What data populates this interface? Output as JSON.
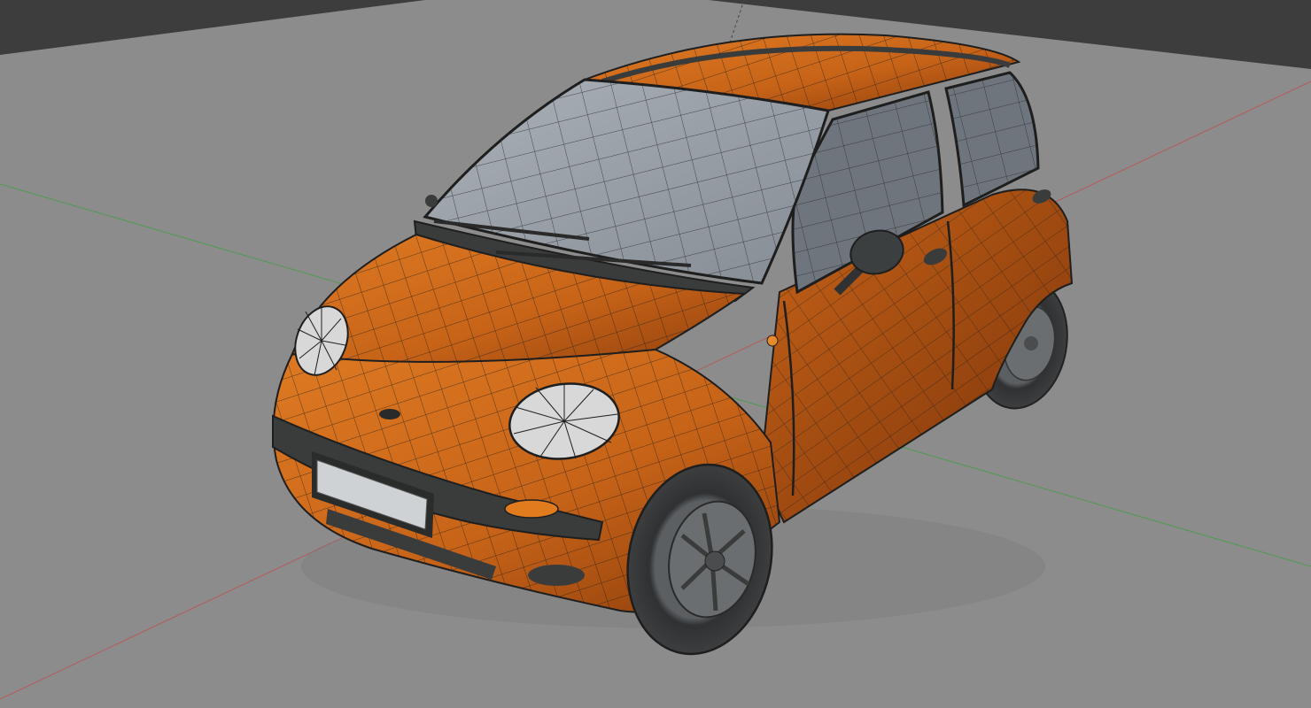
{
  "viewport": {
    "background_color": "#3d3d3d",
    "ground_color": "#8c8c8c",
    "grid_axes": [
      {
        "name": "x-axis",
        "color": "#b45a5a"
      },
      {
        "name": "y-axis",
        "color": "#4f9a4f"
      }
    ],
    "view_mode": "wireframe-on-shaded"
  },
  "model": {
    "type": "hatchback car",
    "body_color": "#c86418",
    "body_dark_color": "#8a3c0c",
    "glass_color": "#9aa1a9",
    "trim_color": "#3a3c3c",
    "wire_color": "#1e1e1e",
    "plate_color": "#cfd2d4"
  }
}
